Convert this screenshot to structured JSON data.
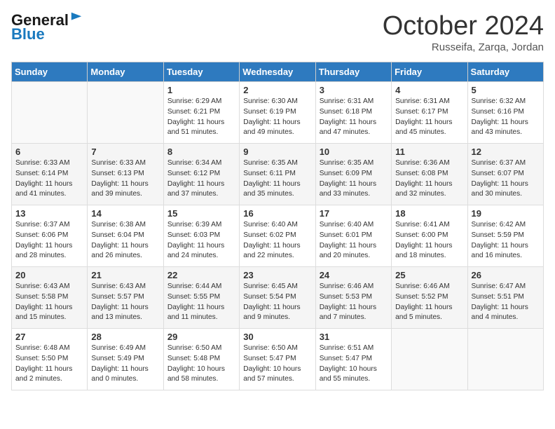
{
  "header": {
    "logo_general": "General",
    "logo_blue": "Blue",
    "title": "October 2024",
    "location": "Russeifa, Zarqa, Jordan"
  },
  "days_of_week": [
    "Sunday",
    "Monday",
    "Tuesday",
    "Wednesday",
    "Thursday",
    "Friday",
    "Saturday"
  ],
  "weeks": [
    [
      {
        "day": "",
        "info": ""
      },
      {
        "day": "",
        "info": ""
      },
      {
        "day": "1",
        "info": "Sunrise: 6:29 AM\nSunset: 6:21 PM\nDaylight: 11 hours and 51 minutes."
      },
      {
        "day": "2",
        "info": "Sunrise: 6:30 AM\nSunset: 6:19 PM\nDaylight: 11 hours and 49 minutes."
      },
      {
        "day": "3",
        "info": "Sunrise: 6:31 AM\nSunset: 6:18 PM\nDaylight: 11 hours and 47 minutes."
      },
      {
        "day": "4",
        "info": "Sunrise: 6:31 AM\nSunset: 6:17 PM\nDaylight: 11 hours and 45 minutes."
      },
      {
        "day": "5",
        "info": "Sunrise: 6:32 AM\nSunset: 6:16 PM\nDaylight: 11 hours and 43 minutes."
      }
    ],
    [
      {
        "day": "6",
        "info": "Sunrise: 6:33 AM\nSunset: 6:14 PM\nDaylight: 11 hours and 41 minutes."
      },
      {
        "day": "7",
        "info": "Sunrise: 6:33 AM\nSunset: 6:13 PM\nDaylight: 11 hours and 39 minutes."
      },
      {
        "day": "8",
        "info": "Sunrise: 6:34 AM\nSunset: 6:12 PM\nDaylight: 11 hours and 37 minutes."
      },
      {
        "day": "9",
        "info": "Sunrise: 6:35 AM\nSunset: 6:11 PM\nDaylight: 11 hours and 35 minutes."
      },
      {
        "day": "10",
        "info": "Sunrise: 6:35 AM\nSunset: 6:09 PM\nDaylight: 11 hours and 33 minutes."
      },
      {
        "day": "11",
        "info": "Sunrise: 6:36 AM\nSunset: 6:08 PM\nDaylight: 11 hours and 32 minutes."
      },
      {
        "day": "12",
        "info": "Sunrise: 6:37 AM\nSunset: 6:07 PM\nDaylight: 11 hours and 30 minutes."
      }
    ],
    [
      {
        "day": "13",
        "info": "Sunrise: 6:37 AM\nSunset: 6:06 PM\nDaylight: 11 hours and 28 minutes."
      },
      {
        "day": "14",
        "info": "Sunrise: 6:38 AM\nSunset: 6:04 PM\nDaylight: 11 hours and 26 minutes."
      },
      {
        "day": "15",
        "info": "Sunrise: 6:39 AM\nSunset: 6:03 PM\nDaylight: 11 hours and 24 minutes."
      },
      {
        "day": "16",
        "info": "Sunrise: 6:40 AM\nSunset: 6:02 PM\nDaylight: 11 hours and 22 minutes."
      },
      {
        "day": "17",
        "info": "Sunrise: 6:40 AM\nSunset: 6:01 PM\nDaylight: 11 hours and 20 minutes."
      },
      {
        "day": "18",
        "info": "Sunrise: 6:41 AM\nSunset: 6:00 PM\nDaylight: 11 hours and 18 minutes."
      },
      {
        "day": "19",
        "info": "Sunrise: 6:42 AM\nSunset: 5:59 PM\nDaylight: 11 hours and 16 minutes."
      }
    ],
    [
      {
        "day": "20",
        "info": "Sunrise: 6:43 AM\nSunset: 5:58 PM\nDaylight: 11 hours and 15 minutes."
      },
      {
        "day": "21",
        "info": "Sunrise: 6:43 AM\nSunset: 5:57 PM\nDaylight: 11 hours and 13 minutes."
      },
      {
        "day": "22",
        "info": "Sunrise: 6:44 AM\nSunset: 5:55 PM\nDaylight: 11 hours and 11 minutes."
      },
      {
        "day": "23",
        "info": "Sunrise: 6:45 AM\nSunset: 5:54 PM\nDaylight: 11 hours and 9 minutes."
      },
      {
        "day": "24",
        "info": "Sunrise: 6:46 AM\nSunset: 5:53 PM\nDaylight: 11 hours and 7 minutes."
      },
      {
        "day": "25",
        "info": "Sunrise: 6:46 AM\nSunset: 5:52 PM\nDaylight: 11 hours and 5 minutes."
      },
      {
        "day": "26",
        "info": "Sunrise: 6:47 AM\nSunset: 5:51 PM\nDaylight: 11 hours and 4 minutes."
      }
    ],
    [
      {
        "day": "27",
        "info": "Sunrise: 6:48 AM\nSunset: 5:50 PM\nDaylight: 11 hours and 2 minutes."
      },
      {
        "day": "28",
        "info": "Sunrise: 6:49 AM\nSunset: 5:49 PM\nDaylight: 11 hours and 0 minutes."
      },
      {
        "day": "29",
        "info": "Sunrise: 6:50 AM\nSunset: 5:48 PM\nDaylight: 10 hours and 58 minutes."
      },
      {
        "day": "30",
        "info": "Sunrise: 6:50 AM\nSunset: 5:47 PM\nDaylight: 10 hours and 57 minutes."
      },
      {
        "day": "31",
        "info": "Sunrise: 6:51 AM\nSunset: 5:47 PM\nDaylight: 10 hours and 55 minutes."
      },
      {
        "day": "",
        "info": ""
      },
      {
        "day": "",
        "info": ""
      }
    ]
  ]
}
